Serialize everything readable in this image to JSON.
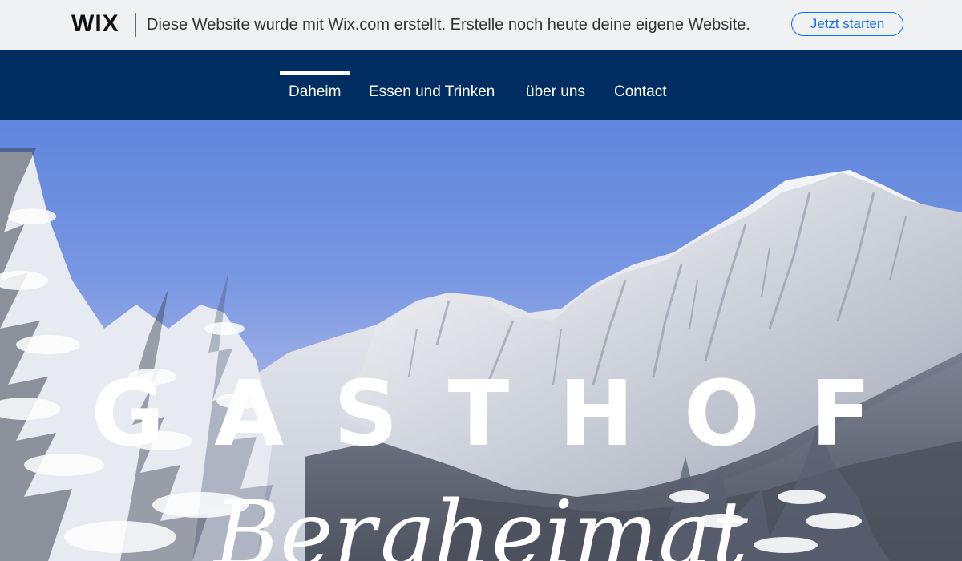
{
  "wix_banner": {
    "logo": "WIX",
    "message": "Diese Website wurde mit Wix.com erstellt. Erstelle noch heute deine eigene Website.",
    "cta_label": "Jetzt starten"
  },
  "nav": {
    "items": [
      {
        "label": "Daheim",
        "active": true
      },
      {
        "label": "Essen und Trinken",
        "active": false
      },
      {
        "label": "über uns",
        "active": false
      },
      {
        "label": "Contact",
        "active": false
      }
    ]
  },
  "hero": {
    "title": "GASTHOF",
    "subtitle": "Bergheimat"
  },
  "colors": {
    "banner_bg": "#eff1f2",
    "nav_bg": "#002d62",
    "cta_accent": "#116dff",
    "sky": "#6f8fdf"
  }
}
